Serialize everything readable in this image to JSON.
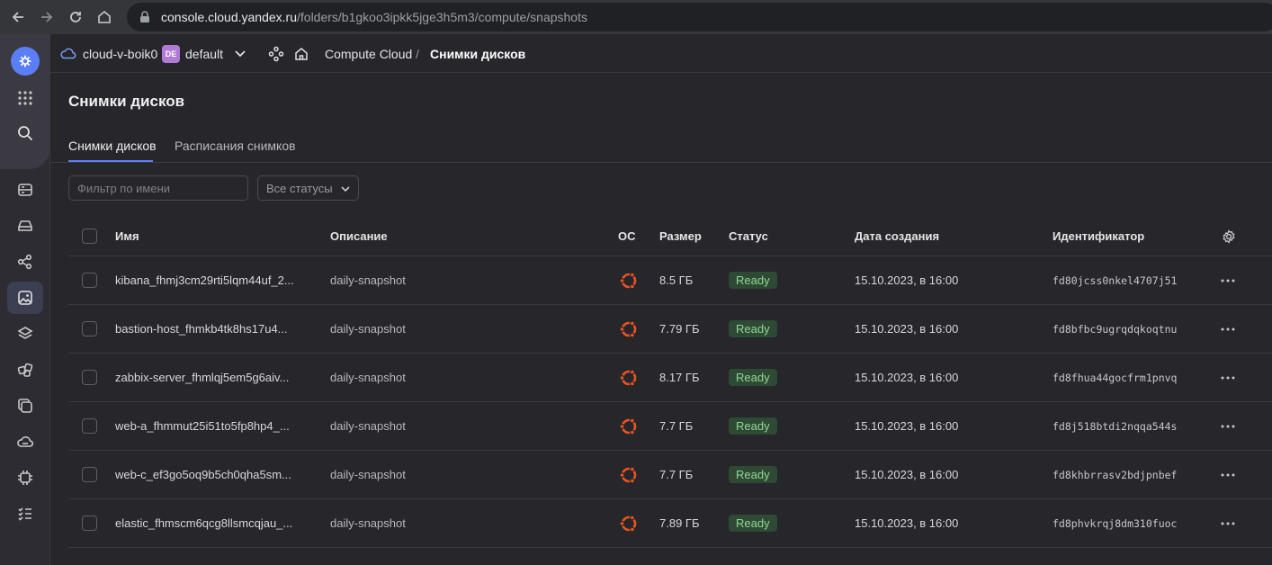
{
  "browser": {
    "url_host": "console.cloud.yandex.ru",
    "url_path": "/folders/b1gkoo3ipkk5jge3h5m3/compute/snapshots"
  },
  "header": {
    "cloud_name": "cloud-v-boik0",
    "folder_badge": "DE",
    "folder_name": "default",
    "breadcrumb_service": "Compute Cloud",
    "breadcrumb_sep": "/",
    "breadcrumb_current": "Снимки дисков"
  },
  "page": {
    "title": "Снимки дисков",
    "tabs": [
      {
        "label": "Снимки дисков"
      },
      {
        "label": "Расписания снимков"
      }
    ]
  },
  "filters": {
    "name_placeholder": "Фильтр по имени",
    "status_label": "Все статусы"
  },
  "table": {
    "headers": {
      "name": "Имя",
      "description": "Описание",
      "os": "ОС",
      "size": "Размер",
      "status": "Статус",
      "created": "Дата создания",
      "id": "Идентификатор"
    },
    "rows": [
      {
        "name": "kibana_fhmj3cm29rti5lqm44uf_2...",
        "description": "daily-snapshot",
        "size": "8.5 ГБ",
        "status": "Ready",
        "created": "15.10.2023, в 16:00",
        "id": "fd80jcss0nkel4707j51"
      },
      {
        "name": "bastion-host_fhmkb4tk8hs17u4...",
        "description": "daily-snapshot",
        "size": "7.79 ГБ",
        "status": "Ready",
        "created": "15.10.2023, в 16:00",
        "id": "fd8bfbc9ugrqdqkoqtnu"
      },
      {
        "name": "zabbix-server_fhmlqj5em5g6aiv...",
        "description": "daily-snapshot",
        "size": "8.17 ГБ",
        "status": "Ready",
        "created": "15.10.2023, в 16:00",
        "id": "fd8fhua44gocfrm1pnvq"
      },
      {
        "name": "web-a_fhmmut25i51to5fp8hp4_...",
        "description": "daily-snapshot",
        "size": "7.7 ГБ",
        "status": "Ready",
        "created": "15.10.2023, в 16:00",
        "id": "fd8j518btdi2nqqa544s"
      },
      {
        "name": "web-c_ef3go5oq9b5ch0qha5sm...",
        "description": "daily-snapshot",
        "size": "7.7 ГБ",
        "status": "Ready",
        "created": "15.10.2023, в 16:00",
        "id": "fd8khbrrasv2bdjpnbef"
      },
      {
        "name": "elastic_fhmscm6qcg8llsmcqjau_...",
        "description": "daily-snapshot",
        "size": "7.89 ГБ",
        "status": "Ready",
        "created": "15.10.2023, в 16:00",
        "id": "fd8phvkrqj8dm310fuoc"
      }
    ]
  },
  "colors": {
    "accent": "#5b7ef7",
    "ubuntu_orange": "#e95420",
    "ready_bg": "#2f4a34",
    "ready_text": "#8fd694"
  }
}
